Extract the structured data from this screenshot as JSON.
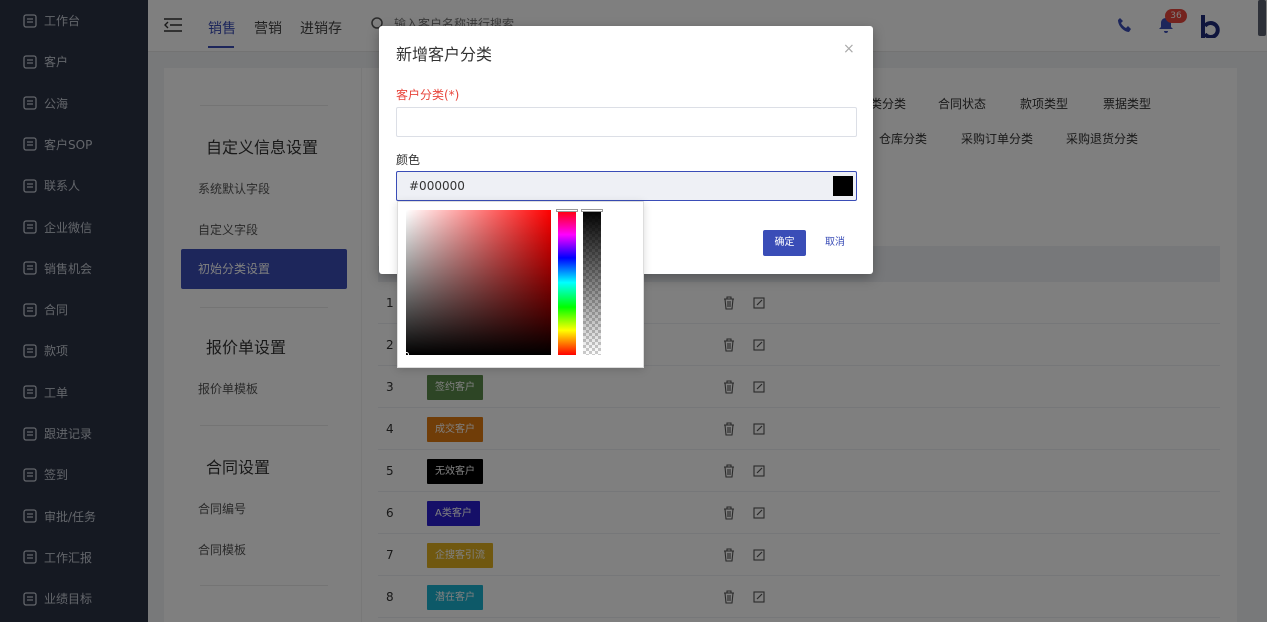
{
  "sidebar": {
    "items": [
      {
        "label": "工作台",
        "icon": "dashboard-icon"
      },
      {
        "label": "客户",
        "icon": "customer-icon"
      },
      {
        "label": "公海",
        "icon": "public-sea-icon"
      },
      {
        "label": "客户SOP",
        "icon": "sop-icon"
      },
      {
        "label": "联系人",
        "icon": "contacts-icon"
      },
      {
        "label": "企业微信",
        "icon": "wechat-icon"
      },
      {
        "label": "销售机会",
        "icon": "money-bag-icon"
      },
      {
        "label": "合同",
        "icon": "contract-icon"
      },
      {
        "label": "款项",
        "icon": "payment-icon"
      },
      {
        "label": "工单",
        "icon": "ticket-icon"
      },
      {
        "label": "跟进记录",
        "icon": "edit-note-icon"
      },
      {
        "label": "签到",
        "icon": "checkin-icon"
      },
      {
        "label": "审批/任务",
        "icon": "approval-icon"
      },
      {
        "label": "工作汇报",
        "icon": "report-icon"
      },
      {
        "label": "业绩目标",
        "icon": "target-icon"
      }
    ]
  },
  "topbar": {
    "tabs": [
      "销售",
      "营销",
      "进销存"
    ],
    "search_placeholder": "输入客户名称进行搜索",
    "notification_count": "36"
  },
  "leftcol": {
    "section1_title": "自定义信息设置",
    "section1_items": [
      "系统默认字段",
      "自定义字段",
      "初始分类设置"
    ],
    "section2_title": "报价单设置",
    "section2_items": [
      "报价单模板"
    ],
    "section3_title": "合同设置",
    "section3_items": [
      "合同编号",
      "合同模板"
    ]
  },
  "category_tabs": {
    "row1": [
      "类分类",
      "合同状态",
      "款项类型",
      "票据类型"
    ],
    "row2": [
      "仓库分类",
      "采购订单分类",
      "采购退货分类"
    ]
  },
  "table": {
    "rows": [
      {
        "index": "1",
        "tag": "",
        "color": ""
      },
      {
        "index": "2",
        "tag": "",
        "color": ""
      },
      {
        "index": "3",
        "tag": "签约客户",
        "color": "#5b8a4a"
      },
      {
        "index": "4",
        "tag": "成交客户",
        "color": "#e07a10"
      },
      {
        "index": "5",
        "tag": "无效客户",
        "color": "#000000"
      },
      {
        "index": "6",
        "tag": "A类客户",
        "color": "#2a1fd0"
      },
      {
        "index": "7",
        "tag": "企搜客引流",
        "color": "#e0b020"
      },
      {
        "index": "8",
        "tag": "潜在客户",
        "color": "#1ab2d0"
      }
    ]
  },
  "modal": {
    "title": "新增客户分类",
    "close": "×",
    "category_label": "客户分类(*)",
    "color_label": "颜色",
    "color_value": "#000000",
    "ok_label": "确定",
    "cancel_label": "取消"
  }
}
